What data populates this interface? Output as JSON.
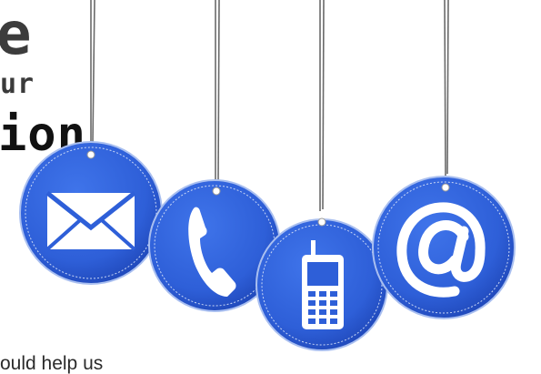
{
  "headline": {
    "line1": "e",
    "line2": "ur",
    "line3": "ion"
  },
  "caption": "ould help us",
  "colors": {
    "tag_blue": "#2e5fd8",
    "tag_blue_dark": "#1f47b8",
    "tag_rim": "#a9bff0",
    "string": "#6a6a6a",
    "icon": "#ffffff"
  },
  "tags": [
    {
      "icon": "envelope-icon"
    },
    {
      "icon": "phone-handset-icon"
    },
    {
      "icon": "mobile-phone-icon"
    },
    {
      "icon": "at-sign-icon"
    }
  ]
}
